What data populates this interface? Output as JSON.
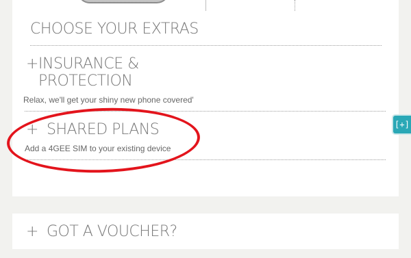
{
  "extras": {
    "title": "CHOOSE YOUR EXTRAS",
    "options": [
      {
        "plus": "+",
        "label": "INSURANCE & PROTECTION",
        "description": "Relax, we'll get your shiny new phone covered'"
      },
      {
        "plus": "+",
        "label": "SHARED PLANS",
        "description": "Add a 4GEE SIM to your existing device"
      }
    ]
  },
  "voucher": {
    "plus": "+",
    "label": "GOT A VOUCHER?"
  },
  "side_tab": {
    "label": "[+]"
  },
  "colors": {
    "annotation": "#e3141c",
    "accent": "#2aa8b6",
    "heading": "#777777"
  },
  "icons": [
    "plus-icon",
    "expand-icon"
  ]
}
